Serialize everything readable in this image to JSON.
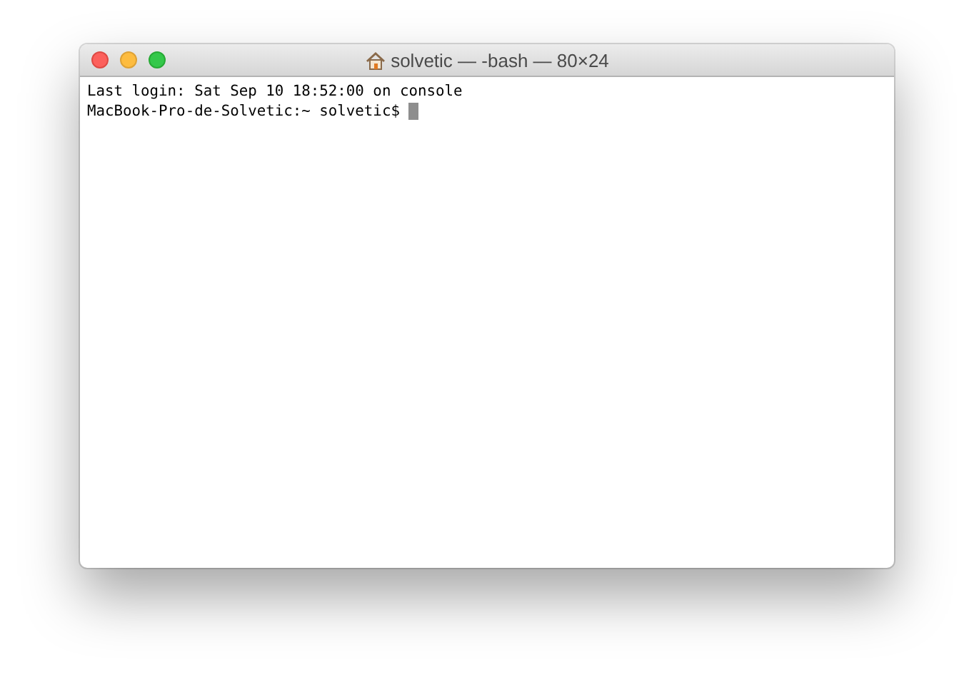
{
  "window": {
    "title": "solvetic — -bash — 80×24"
  },
  "terminal": {
    "lines": [
      {
        "text": "Last login: Sat Sep 10 18:52:00 on console"
      },
      {
        "text": "MacBook-Pro-de-Solvetic:~ solvetic$ "
      }
    ],
    "cursor": true
  }
}
